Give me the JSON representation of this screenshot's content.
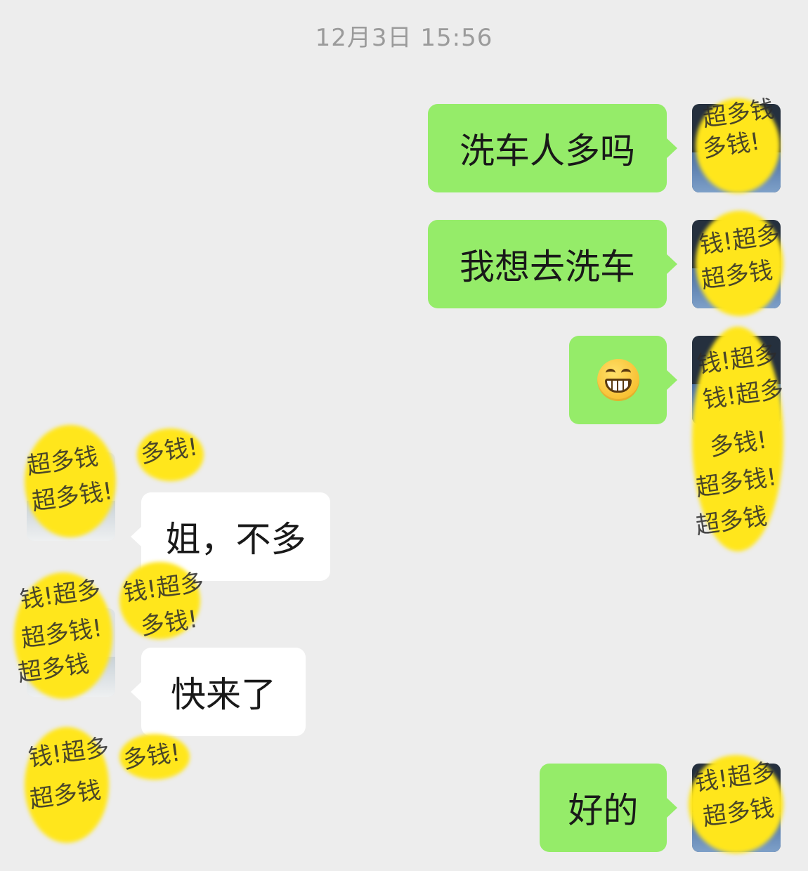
{
  "timestamp": "12月3日 15:56",
  "messages": [
    {
      "side": "out",
      "text": "洗车人多吗"
    },
    {
      "side": "out",
      "text": "我想去洗车"
    },
    {
      "side": "out",
      "emoji": "grinning-face-emoji"
    },
    {
      "side": "in",
      "text": "姐，不多"
    },
    {
      "side": "in",
      "text": "快来了"
    },
    {
      "side": "out",
      "text": "好的"
    }
  ],
  "mosaic_text": {
    "a": "超多钱",
    "b": "钱!超多",
    "c": "多钱!",
    "d": "超多钱!"
  },
  "colors": {
    "background": "#ededed",
    "outgoing_bubble": "#95ec69",
    "incoming_bubble": "#ffffff",
    "timestamp": "#9b9b9b",
    "redaction": "#ffe61c"
  }
}
